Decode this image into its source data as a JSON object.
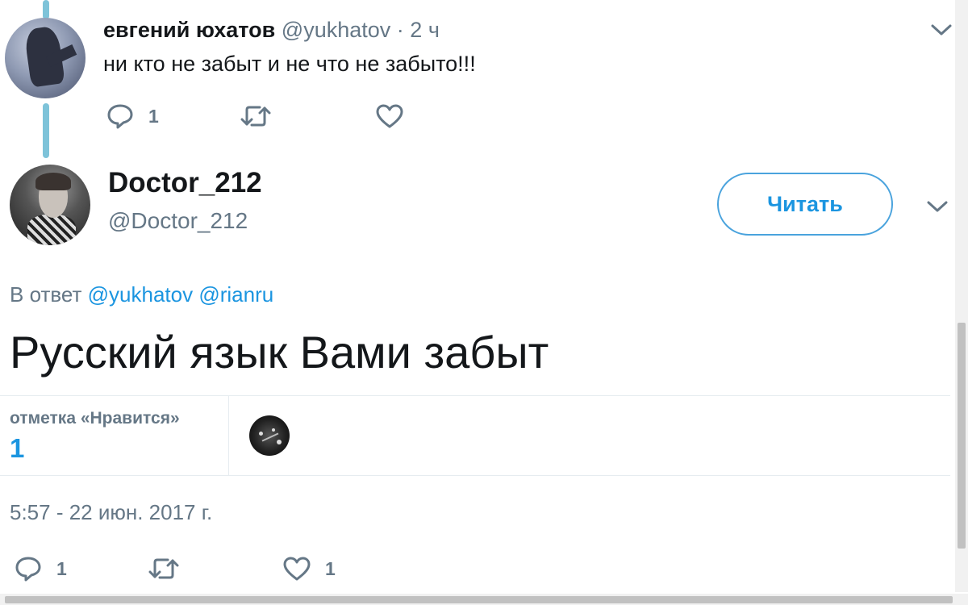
{
  "parent_tweet": {
    "author_name": "евгений юхатов",
    "author_handle": "@yukhatov",
    "separator": "·",
    "time": "2 ч",
    "text": "ни кто не забыт и не что не забыто!!!",
    "reply_count": "1",
    "retweet_count": "",
    "like_count": ""
  },
  "main_tweet": {
    "author_name": "Doctor_212",
    "author_handle": "@Doctor_212",
    "follow_label": "Читать",
    "reply_prefix": "В ответ",
    "reply_mentions": [
      "@yukhatov",
      "@rianru"
    ],
    "text": "Русский язык Вами забыт",
    "likes_label": "отметка «Нравится»",
    "likes_count": "1",
    "timestamp": "5:57 - 22 июн. 2017 г.",
    "reply_count": "1",
    "retweet_count": "",
    "like_count": "1"
  },
  "icons": {
    "reply": "reply-icon",
    "retweet": "retweet-icon",
    "like": "heart-icon",
    "more": "chevron-down-icon"
  },
  "colors": {
    "accent": "#1b95e0",
    "secondary_text": "#657786",
    "primary_text": "#14171a",
    "thread_line": "#7ec3d9",
    "divider": "#e6ecf0"
  }
}
